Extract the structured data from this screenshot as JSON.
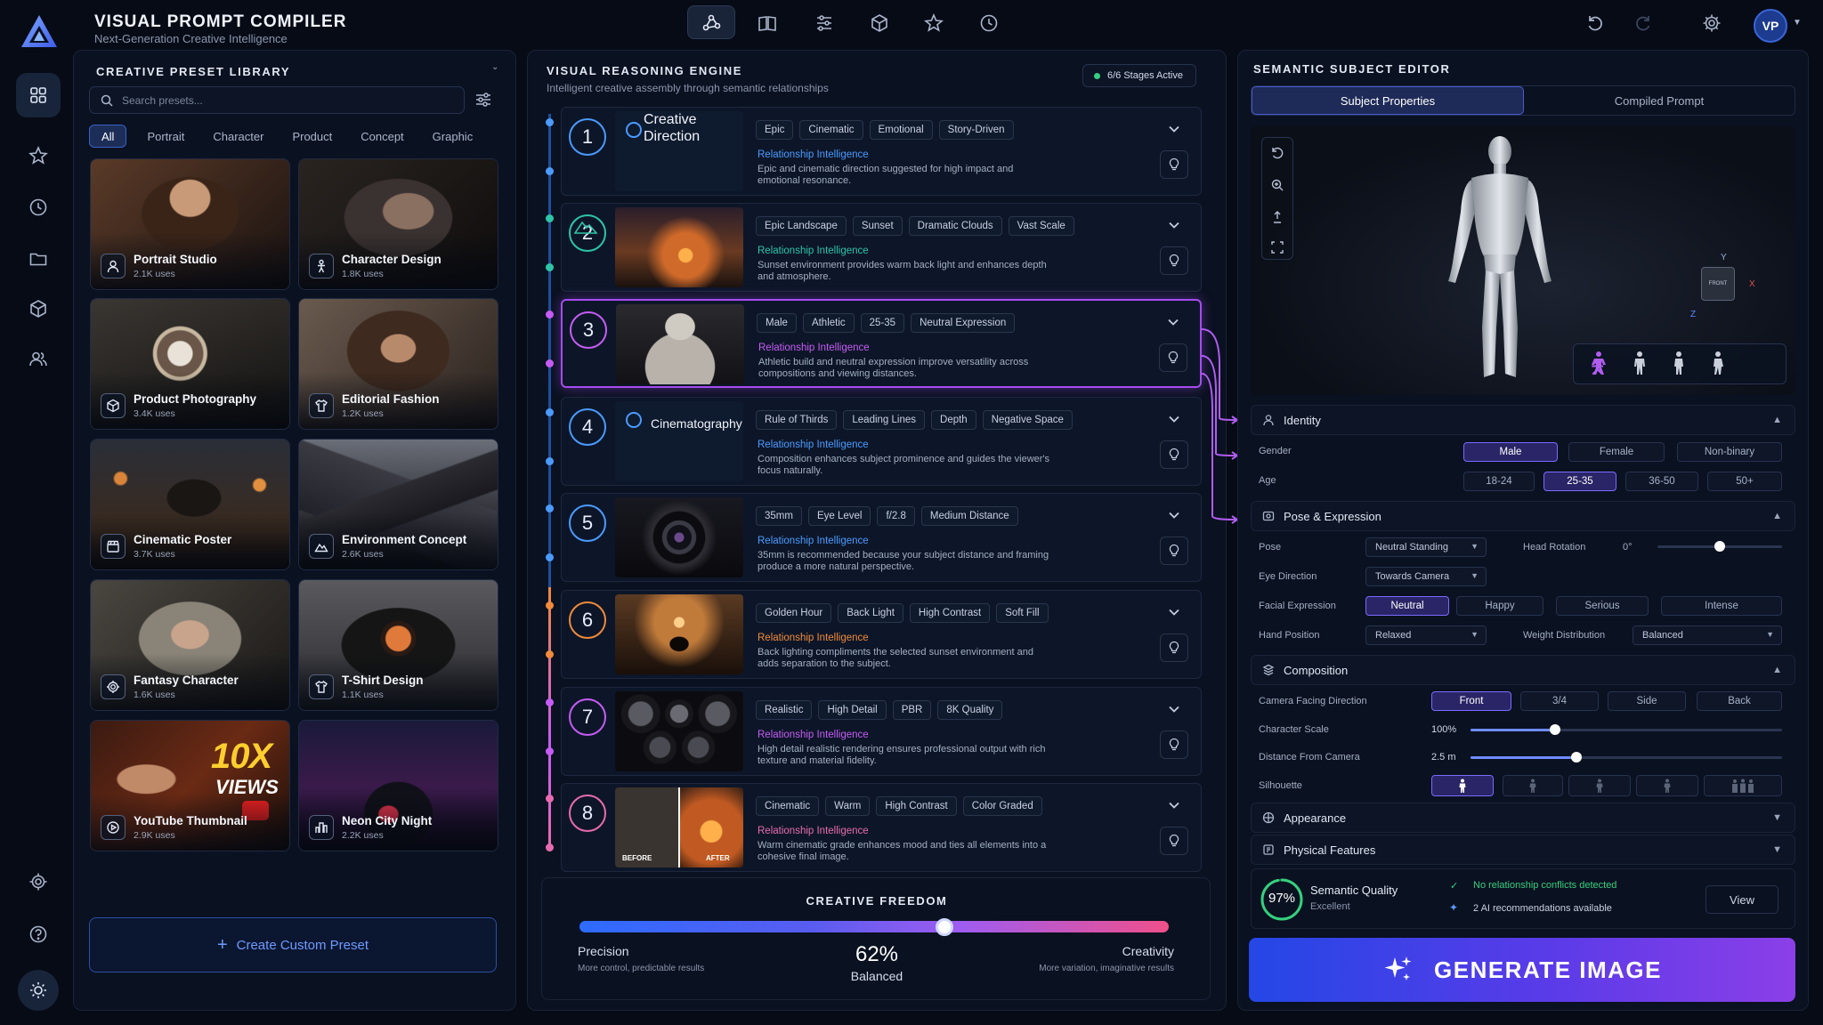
{
  "app": {
    "title": "VISUAL PROMPT COMPILER",
    "subtitle": "Next-Generation Creative Intelligence",
    "avatar": "VP"
  },
  "library": {
    "title": "CREATIVE PRESET LIBRARY",
    "search_placeholder": "Search presets...",
    "filters": [
      "All",
      "Portrait",
      "Character",
      "Product",
      "Concept",
      "Graphic"
    ],
    "presets": [
      {
        "title": "Portrait Studio",
        "uses": "2.1K uses",
        "icon": "user-icon"
      },
      {
        "title": "Character Design",
        "uses": "1.8K uses",
        "icon": "figure-icon"
      },
      {
        "title": "Product Photography",
        "uses": "3.4K uses",
        "icon": "cube-icon"
      },
      {
        "title": "Editorial Fashion",
        "uses": "1.2K uses",
        "icon": "shirt-icon"
      },
      {
        "title": "Cinematic Poster",
        "uses": "3.7K uses",
        "icon": "clapper-icon"
      },
      {
        "title": "Environment Concept",
        "uses": "2.6K uses",
        "icon": "mountain-icon"
      },
      {
        "title": "Fantasy Character",
        "uses": "1.6K uses",
        "icon": "gear-icon"
      },
      {
        "title": "T-Shirt Design",
        "uses": "1.1K uses",
        "icon": "shirt-icon"
      },
      {
        "title": "YouTube Thumbnail",
        "uses": "2.9K uses",
        "icon": "play-icon"
      },
      {
        "title": "Neon City Night",
        "uses": "2.2K uses",
        "icon": "city-icon"
      }
    ],
    "thumb_text": {
      "big": "10X",
      "small": "VIEWS"
    },
    "create_label": "Create Custom Preset"
  },
  "engine": {
    "title": "VISUAL REASONING ENGINE",
    "subtitle": "Intelligent creative assembly through semantic relationships",
    "stages_status": "6/6 Stages Active",
    "ri_label": "Relationship Intelligence",
    "stages": [
      {
        "num": "1",
        "name": "Creative Direction",
        "tags": [
          "Epic",
          "Cinematic",
          "Emotional",
          "Story-Driven"
        ],
        "desc": "Epic and cinematic direction suggested for high impact and emotional resonance.",
        "color": "#4b9bff"
      },
      {
        "num": "2",
        "name": "",
        "tags": [
          "Epic Landscape",
          "Sunset",
          "Dramatic Clouds",
          "Vast Scale"
        ],
        "desc": "Sunset environment provides warm back light and enhances depth and atmosphere.",
        "color": "#2ec4a8"
      },
      {
        "num": "3",
        "name": "",
        "tags": [
          "Male",
          "Athletic",
          "25-35",
          "Neutral Expression"
        ],
        "desc": "Athletic build and neutral expression improve versatility across compositions and viewing distances.",
        "color": "#c65cf5"
      },
      {
        "num": "4",
        "name": "Cinematography",
        "tags": [
          "Rule of Thirds",
          "Leading Lines",
          "Depth",
          "Negative Space"
        ],
        "desc": "Composition enhances subject prominence and guides the viewer's focus naturally.",
        "color": "#4b9bff"
      },
      {
        "num": "5",
        "name": "",
        "tags": [
          "35mm",
          "Eye Level",
          "f/2.8",
          "Medium Distance"
        ],
        "desc": "35mm is recommended because your subject distance and framing produce a more natural perspective.",
        "color": "#4b9bff"
      },
      {
        "num": "6",
        "name": "",
        "tags": [
          "Golden Hour",
          "Back Light",
          "High Contrast",
          "Soft Fill"
        ],
        "desc": "Back lighting compliments the selected sunset environment and adds separation to the subject.",
        "color": "#f08a3c"
      },
      {
        "num": "7",
        "name": "",
        "tags": [
          "Realistic",
          "High Detail",
          "PBR",
          "8K Quality"
        ],
        "desc": "High detail realistic rendering ensures professional output with rich texture and material fidelity.",
        "color": "#c65cf5"
      },
      {
        "num": "8",
        "name": "",
        "tags": [
          "Cinematic",
          "Warm",
          "High Contrast",
          "Color Graded"
        ],
        "desc": "Warm cinematic grade enhances mood and ties all elements into a cohesive final image.",
        "color": "#e86bb0"
      }
    ],
    "before_label": "BEFORE",
    "after_label": "AFTER",
    "freedom": {
      "title": "CREATIVE FREEDOM",
      "value": 0.62,
      "value_text": "62%",
      "value_label": "Balanced",
      "left_label": "Precision",
      "left_desc": "More control, predictable results",
      "right_label": "Creativity",
      "right_desc": "More variation, imaginative results"
    }
  },
  "editor": {
    "title": "SEMANTIC SUBJECT EDITOR",
    "tabs": [
      "Subject Properties",
      "Compiled Prompt"
    ],
    "gizmo": {
      "front": "FRONT",
      "x": "X",
      "y": "Y",
      "z": "Z"
    },
    "identity": {
      "title": "Identity",
      "gender_label": "Gender",
      "gender_opts": [
        "Male",
        "Female",
        "Non-binary"
      ],
      "age_label": "Age",
      "age_opts": [
        "18-24",
        "25-35",
        "36-50",
        "50+"
      ]
    },
    "pose": {
      "title": "Pose & Expression",
      "pose_label": "Pose",
      "pose_value": "Neutral Standing",
      "head_label": "Head Rotation",
      "head_value": "0°",
      "head_fraction": 0.5,
      "eye_label": "Eye Direction",
      "eye_value": "Towards Camera",
      "face_label": "Facial Expression",
      "face_opts": [
        "Neutral",
        "Happy",
        "Serious",
        "Intense"
      ],
      "hand_label": "Hand Position",
      "hand_value": "Relaxed",
      "weight_label": "Weight Distribution",
      "weight_value": "Balanced"
    },
    "composition": {
      "title": "Composition",
      "facing_label": "Camera Facing Direction",
      "facing_opts": [
        "Front",
        "3/4",
        "Side",
        "Back"
      ],
      "scale_label": "Character Scale",
      "scale_value": "100%",
      "scale_fraction": 0.27,
      "distance_label": "Distance From Camera",
      "distance_value": "2.5 m",
      "distance_fraction": 0.34,
      "silhouette_label": "Silhouette"
    },
    "appearance_title": "Appearance",
    "physical_title": "Physical Features",
    "quality": {
      "score": "97%",
      "score_fraction": 0.97,
      "label": "Semantic Quality",
      "rating": "Excellent",
      "conflicts": "No relationship conflicts detected",
      "recs": "2 AI recommendations available",
      "view_label": "View"
    },
    "generate_label": "GENERATE IMAGE"
  },
  "colors": {
    "accent": "#3a66ff",
    "purple": "#a54cf0",
    "teal": "#2ec4a8",
    "orange": "#f08a3c",
    "green": "#35d07f"
  }
}
